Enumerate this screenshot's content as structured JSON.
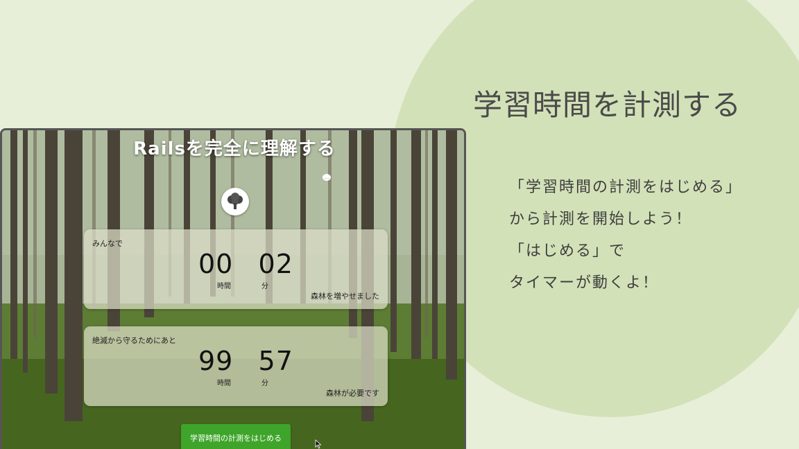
{
  "slide": {
    "heading": "学習時間を計測する",
    "lines": [
      "「学習時間の計測をはじめる」",
      "から計測を開始しよう！",
      "「はじめる」で",
      "タイマーが動くよ！"
    ]
  },
  "app": {
    "title": "Railsを完全に理解する",
    "avatar_icon": "broccoli-tree-icon",
    "everyone_card": {
      "label": "みんなで",
      "hours": "00",
      "minutes": "02",
      "hours_unit": "時間",
      "minutes_unit": "分",
      "footer": "森林を増やせました"
    },
    "remaining_card": {
      "label": "絶滅から守るためにあと",
      "hours": "99",
      "minutes": "57",
      "hours_unit": "時間",
      "minutes_unit": "分",
      "footer": "森林が必要です"
    },
    "start_button": "学習時間の計測をはじめる"
  },
  "colors": {
    "background": "#e8efd8",
    "circle": "#d3e1b8",
    "button": "#3ea52a"
  }
}
